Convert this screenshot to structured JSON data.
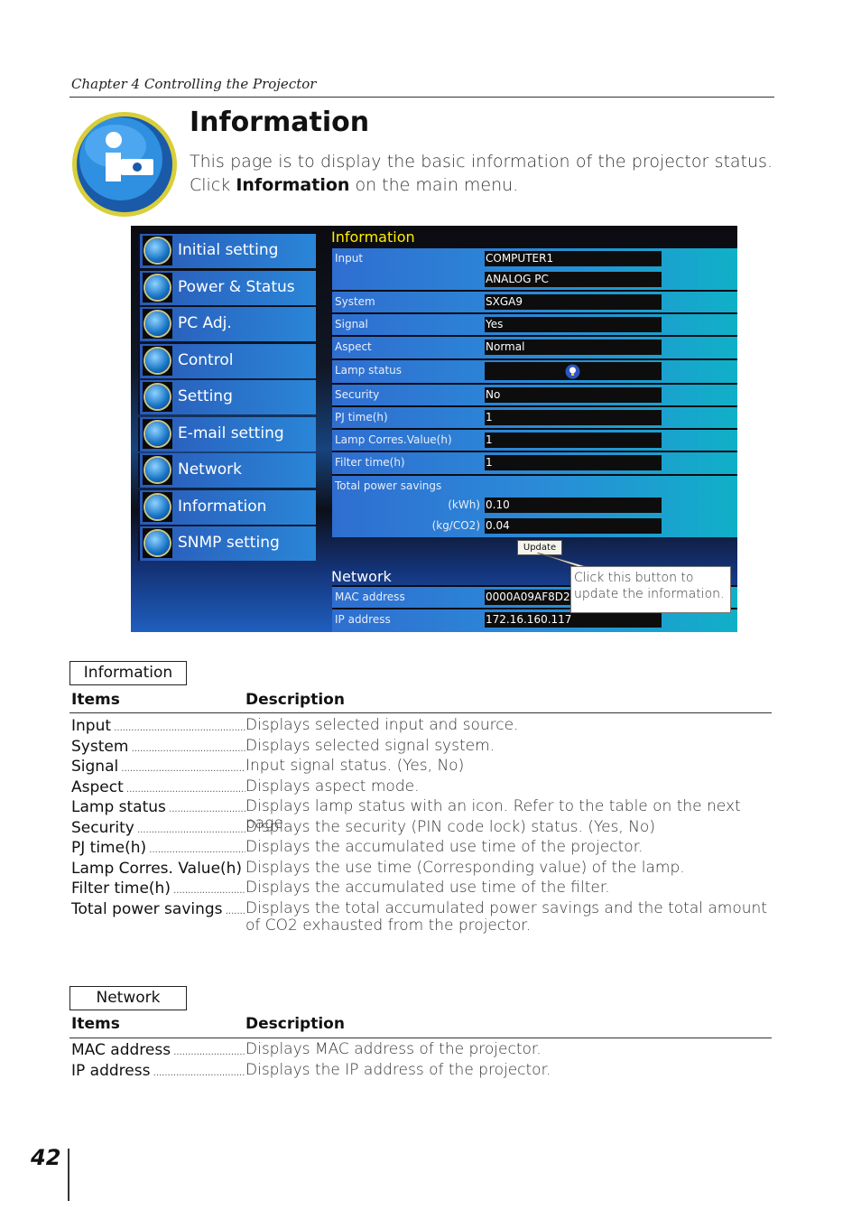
{
  "header": {
    "chapter": "Chapter 4 Controlling the Projector"
  },
  "title": "Information",
  "intro": {
    "text1": "This page is to display the basic information of the projector status. Click ",
    "bold": "Information",
    "text2": " on the main menu."
  },
  "screenshot": {
    "menu": [
      "Initial setting",
      "Power & Status",
      "PC Adj.",
      "Control",
      "Setting",
      "E-mail setting",
      "Network",
      "Information",
      "SNMP setting"
    ],
    "info_title": "Information",
    "rows": {
      "input": {
        "label": "Input",
        "values": [
          "COMPUTER1",
          "ANALOG PC"
        ]
      },
      "system": {
        "label": "System",
        "value": "SXGA9"
      },
      "signal": {
        "label": "Signal",
        "value": "Yes"
      },
      "aspect": {
        "label": "Aspect",
        "value": "Normal"
      },
      "lamp_status": {
        "label": "Lamp status",
        "icon": "lamp-bulb-icon"
      },
      "security": {
        "label": "Security",
        "value": "No"
      },
      "pj_time": {
        "label": "PJ time(h)",
        "value": "1"
      },
      "lamp_corres": {
        "label": "Lamp Corres.Value(h)",
        "value": "1"
      },
      "filter_time": {
        "label": "Filter time(h)",
        "value": "1"
      },
      "total_power": {
        "label": "Total power savings",
        "kwh_unit": "(kWh)",
        "kwh": "0.10",
        "co2_unit": "(kg/CO2)",
        "co2": "0.04"
      }
    },
    "update_label": "Update",
    "network_title": "Network",
    "mac": {
      "label": "MAC address",
      "value": "0000A09AF8D2"
    },
    "ip": {
      "label": "IP address",
      "value": "172.16.160.117"
    },
    "callout": "Click this button to update the information."
  },
  "info_table": {
    "section": "Information",
    "col_items": "Items",
    "col_desc": "Description",
    "rows": [
      {
        "name": "Input",
        "desc": "Displays selected input and source."
      },
      {
        "name": "System",
        "desc": "Displays selected signal system."
      },
      {
        "name": "Signal",
        "desc": "Input signal status. (Yes, No)"
      },
      {
        "name": "Aspect",
        "desc": "Displays aspect mode."
      },
      {
        "name": "Lamp status",
        "desc": "Displays lamp status with an icon. Refer to the table on the next page."
      },
      {
        "name": "Security",
        "desc": "Displays the security (PIN code lock) status. (Yes, No)"
      },
      {
        "name": "PJ time(h)",
        "desc": "Displays the accumulated use time of the projector."
      },
      {
        "name": "Lamp Corres. Value(h)",
        "desc": "Displays the use time (Corresponding value) of the lamp."
      },
      {
        "name": "Filter time(h)",
        "desc": "Displays the accumulated use time of the filter."
      },
      {
        "name": "Total power savings",
        "desc": "Displays the total accumulated power savings and the total amount of CO2 exhausted from the projector."
      }
    ]
  },
  "network_table": {
    "section": "Network",
    "col_items": "Items",
    "col_desc": "Description",
    "rows": [
      {
        "name": "MAC address",
        "desc": "Displays MAC address of the projector."
      },
      {
        "name": "IP address",
        "desc": "Displays the IP address of the projector."
      }
    ]
  },
  "page_number": "42"
}
